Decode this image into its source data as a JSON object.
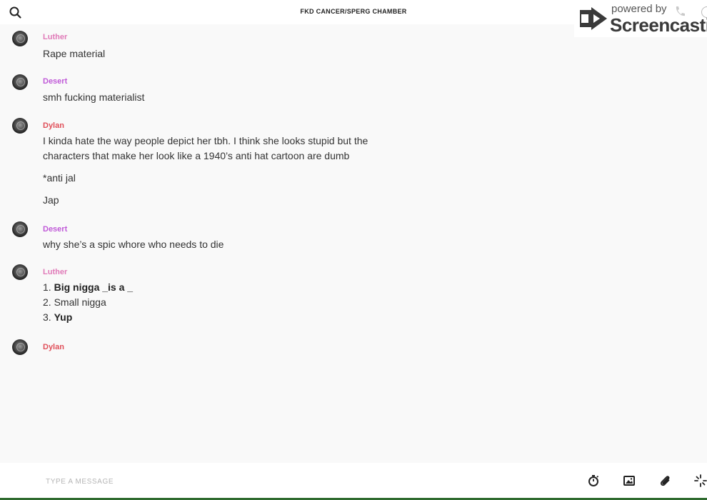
{
  "header": {
    "title": "FKD CANCER/SPERG CHAMBER",
    "search_icon": "search-icon"
  },
  "watermark": {
    "powered": "powered by",
    "brand": "Screencastify"
  },
  "colors": {
    "luther": "#e07ab8",
    "desert": "#c05ad8",
    "dylan": "#e0505a"
  },
  "messages": [
    {
      "sender": "Luther",
      "lines": [
        "Rape material"
      ]
    },
    {
      "sender": "Desert",
      "lines": [
        "smh fucking materialist"
      ]
    },
    {
      "sender": "Dylan",
      "lines": [
        "I kinda hate the way people depict her tbh. I think she looks stupid but the",
        "characters that make her look like a 1940’s anti hat cartoon are dumb",
        "*anti jal",
        "Jap"
      ]
    },
    {
      "sender": "Desert",
      "lines": [
        "why she’s a spic whore who needs to die"
      ]
    },
    {
      "sender": "Luther",
      "list": [
        {
          "num": "1.",
          "text": "Big nigga _is a _",
          "bold": true
        },
        {
          "num": "2.",
          "text": "Small nigga",
          "bold": false
        },
        {
          "num": "3.",
          "text": "Yup",
          "bold": true
        }
      ]
    },
    {
      "sender": "Dylan",
      "lines": []
    }
  ],
  "composer": {
    "placeholder": "TYPE A MESSAGE",
    "tools": [
      "timer-icon",
      "image-icon",
      "attachment-icon",
      "sparkle-icon"
    ]
  }
}
